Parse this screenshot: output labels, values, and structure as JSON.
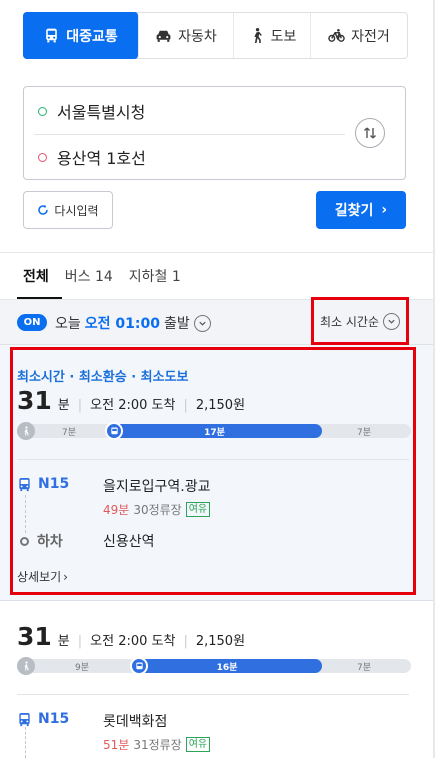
{
  "modes": [
    {
      "label": "대중교통",
      "icon": "bus-icon",
      "active": true
    },
    {
      "label": "자동차",
      "icon": "car-icon",
      "active": false
    },
    {
      "label": "도보",
      "icon": "walk-icon",
      "active": false
    },
    {
      "label": "자전거",
      "icon": "bicycle-icon",
      "active": false
    }
  ],
  "route": {
    "start": "서울특별시청",
    "end": "용산역 1호선",
    "swap_icon": "swap-icon"
  },
  "buttons": {
    "reset": "다시입력",
    "search": "길찾기"
  },
  "result_tabs": [
    {
      "label": "전체",
      "active": true
    },
    {
      "label": "버스 14",
      "active": false
    },
    {
      "label": "지하철 1",
      "active": false
    }
  ],
  "filter": {
    "on_badge": "ON",
    "day": "오늘",
    "time": "오전 01:00",
    "suffix": "출발",
    "sort": "최소 시간순"
  },
  "results": [
    {
      "tags": "최소시간 · 최소환승 · 최소도보",
      "duration": "31",
      "duration_unit": "분",
      "arrival": "오전 2:00 도착",
      "fare": "2,150원",
      "timeline": {
        "walk_before": "7분",
        "bus": "17분",
        "walk_after": "7분"
      },
      "route_no": "N15",
      "board_stop": "을지로입구역.광교",
      "eta_min": "49분",
      "eta_stops": "30정류장",
      "congestion": "여유",
      "alight_label": "하차",
      "alight_stop": "신용산역",
      "detail": "상세보기"
    },
    {
      "duration": "31",
      "duration_unit": "분",
      "arrival": "오전 2:00 도착",
      "fare": "2,150원",
      "timeline": {
        "walk_before": "9분",
        "bus": "16분",
        "walk_after": "7분"
      },
      "route_no": "N15",
      "board_stop": "롯데백화점",
      "eta_min": "51분",
      "eta_stops": "31정류장",
      "congestion": "여유"
    }
  ]
}
